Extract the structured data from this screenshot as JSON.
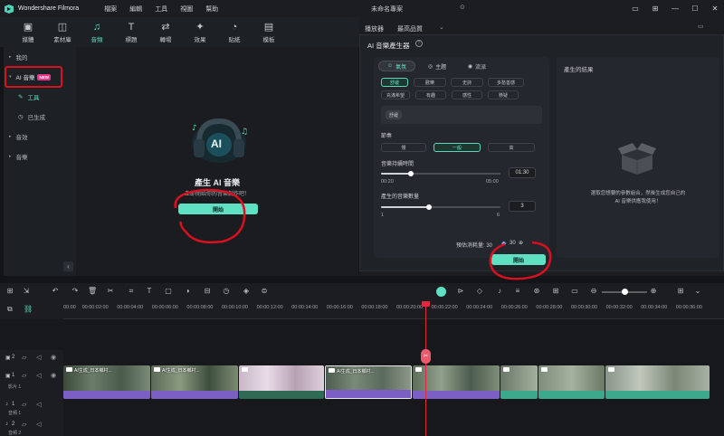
{
  "app": {
    "name": "Wondershare Filmora",
    "project": "未命名專案"
  },
  "menu": [
    "檔案",
    "編輯",
    "工具",
    "視圖",
    "幫助"
  ],
  "toolbar": [
    {
      "label": "媒體",
      "icon": "media-icon"
    },
    {
      "label": "素材庫",
      "icon": "stock-icon"
    },
    {
      "label": "音頻",
      "icon": "audio-icon",
      "active": true
    },
    {
      "label": "標題",
      "icon": "title-icon"
    },
    {
      "label": "轉場",
      "icon": "transition-icon"
    },
    {
      "label": "效果",
      "icon": "effects-icon"
    },
    {
      "label": "貼紙",
      "icon": "sticker-icon"
    },
    {
      "label": "模板",
      "icon": "template-icon"
    }
  ],
  "sidebar": {
    "items": [
      {
        "label": "我的",
        "caret": "▸"
      },
      {
        "label": "AI 音樂",
        "caret": "▾",
        "badge": "NEW"
      },
      {
        "label": "工具",
        "icon": "tool-icon"
      },
      {
        "label": "已生成",
        "icon": "history-icon"
      },
      {
        "label": "音效",
        "caret": "▸"
      },
      {
        "label": "音樂",
        "caret": "▸"
      }
    ]
  },
  "main": {
    "title": "產生 AI 音樂",
    "subtitle": "立即開始你的音樂創作吧！",
    "start_button": "開始",
    "ai_badge": "AI",
    "collapse_glyph": "‹"
  },
  "preview": {
    "label": "播放器",
    "quality": "最高品質"
  },
  "dialog": {
    "title": "AI 音樂產生器",
    "help_glyph": "?",
    "tabs": [
      "氣氛",
      "主題",
      "流派"
    ],
    "mood_chips_row1": [
      "舒緩",
      "歡樂",
      "史詩",
      "多愁善感"
    ],
    "mood_chips_row2": [
      "充滿希望",
      "有趣",
      "感性",
      "懸疑"
    ],
    "selected_tag": "舒緩",
    "tempo_label": "節奏",
    "tempo_options": [
      "慢",
      "一般",
      "高"
    ],
    "duration_label": "音樂持續時間",
    "duration_value": "01:30",
    "duration_min": "00:20",
    "duration_max": "05:00",
    "duration_fraction": 0.25,
    "count_label": "產生的音樂數量",
    "count_value": "3",
    "count_min": "1",
    "count_max": "6",
    "count_fraction": 0.4,
    "cost_label": "預估消耗量: 30",
    "cost_value": "30",
    "generate_button": "開始",
    "result_title": "產生的結果",
    "result_hint_line1": "選取您想要的參數組合，然後生成您自己的",
    "result_hint_line2": "AI 音樂供應我使用！"
  },
  "timeline": {
    "ruler": [
      "00:00",
      "00:00:02:00",
      "00:00:04:00",
      "00:00:06:00",
      "00:00:08:00",
      "00:00:10:00",
      "00:00:12:00",
      "00:00:14:00",
      "00:00:16:00",
      "00:00:18:00",
      "00:00:20:00",
      "00:00:22:00",
      "00:00:24:00",
      "00:00:26:00",
      "00:00:28:00",
      "00:00:30:00",
      "00:00:32:00",
      "00:00:34:00",
      "00:00:36:00"
    ],
    "tracks": [
      {
        "num": "2",
        "label": ""
      },
      {
        "num": "1",
        "label": "影片 1"
      },
      {
        "num": "1",
        "label": "音頻 1"
      },
      {
        "num": "2",
        "label": "音頻 2"
      }
    ],
    "clips": [
      {
        "label": "AI生成_日本鄉村..."
      },
      {
        "label": "AI生成_日本鄉村..."
      },
      {
        "label": ""
      },
      {
        "label": "AI生成_日本鄉村..."
      },
      {
        "label": ""
      },
      {
        "label": ""
      },
      {
        "label": ""
      },
      {
        "label": ""
      }
    ]
  },
  "colors": {
    "accent": "#5fe0c2",
    "playhead": "#e0283f",
    "annotation": "#d8101f"
  }
}
